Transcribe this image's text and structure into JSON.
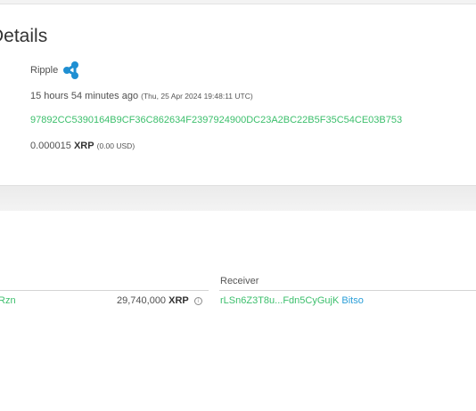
{
  "header": {
    "title": "Details"
  },
  "details": {
    "coin_name": "Ripple",
    "coin_icon": "ripple-logo-icon",
    "time_ago": "15 hours 54 minutes ago",
    "timestamp": "(Thu, 25 Apr 2024 19:48:11 UTC)",
    "tx_hash": "97892CC5390164B9CF36C862634F2397924900DC23A2BC22B5F35C54CE03B753",
    "amount_value": "0.000015",
    "amount_unit": "XRP",
    "amount_usd": "(0.00 USD)"
  },
  "transfers": {
    "receiver_header": "Receiver",
    "rows": [
      {
        "sender": "Rzn",
        "amount_value": "29,740,000",
        "amount_unit": "XRP",
        "info_icon": "info-icon",
        "receiver": "rLSn6Z3T8u...Fdn5CyGujK",
        "receiver_tag": "Bitso"
      }
    ]
  },
  "colors": {
    "link_green": "#3cbf6c",
    "tag_blue": "#2a9ed8",
    "ripple_blue": "#1f8fd2"
  }
}
